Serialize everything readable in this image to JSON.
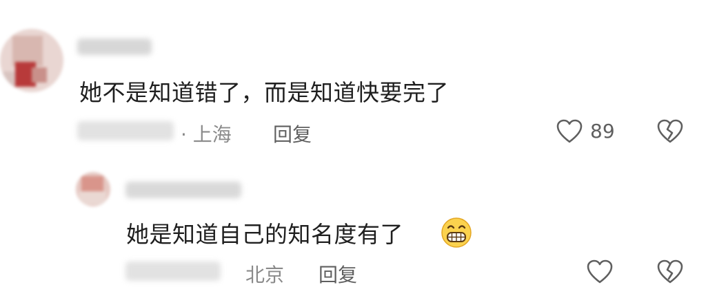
{
  "comments": [
    {
      "text": "她不是知道错了，而是知道快要完了",
      "meta_suffix": "· 上海",
      "reply_label": "回复",
      "like_count": "89"
    },
    {
      "text": "她是知道自己的知名度有了",
      "meta_suffix": "北京",
      "reply_label": "回复"
    }
  ],
  "colors": {
    "text": "#1f1f1f",
    "meta": "#8a8a8a",
    "icon": "#5f5f5f",
    "emoji_face": "#fbd24e"
  },
  "icons": [
    "heart-icon",
    "broken-heart-icon",
    "grinning-face-emoji"
  ]
}
